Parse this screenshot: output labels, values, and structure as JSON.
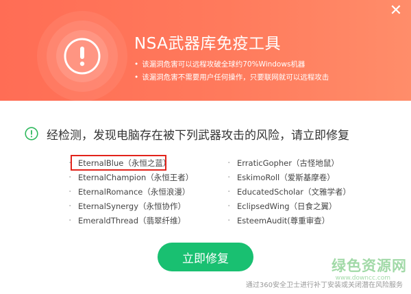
{
  "header": {
    "title": "NSA武器库免疫工具",
    "bullets": [
      "该漏洞危害可以远程攻破全球约70%Windows机器",
      "该漏洞危害不需要用户任何操作，只要联网就可以远程攻击"
    ],
    "close_symbol": "✕",
    "warning_icon": "exclamation-icon"
  },
  "result": {
    "message": "经检测，发现电脑存在被下列武器攻击的风险，请立即修复",
    "status_icon": "exclamation-circle-icon",
    "accent_color": "#2eb85c"
  },
  "weapons": {
    "left": [
      "EternalBlue（永恒之蓝）",
      "EternalChampion（永恒王者）",
      "EternalRomance（永恒浪漫）",
      "EternalSynergy（永恒协作）",
      "EmeraldThread（翡翠纤维）"
    ],
    "right": [
      "ErraticGopher（古怪地鼠）",
      "EskimoRoll（爱斯基摩卷）",
      "EducatedScholar（文雅学者）",
      "EclipsedWing（日食之翼）",
      "EsteemAudit(尊重审查）"
    ]
  },
  "fix_button_label": "立即修复",
  "footer_note": "通过360安全卫士进行补丁安装或关闭潜在风险服务",
  "watermark": {
    "text": "绿色资源网",
    "url": "www.downcc.com"
  },
  "colors": {
    "header_bg": "#ff7458",
    "button_green": "#19c071",
    "highlight_red": "#e2231a"
  }
}
